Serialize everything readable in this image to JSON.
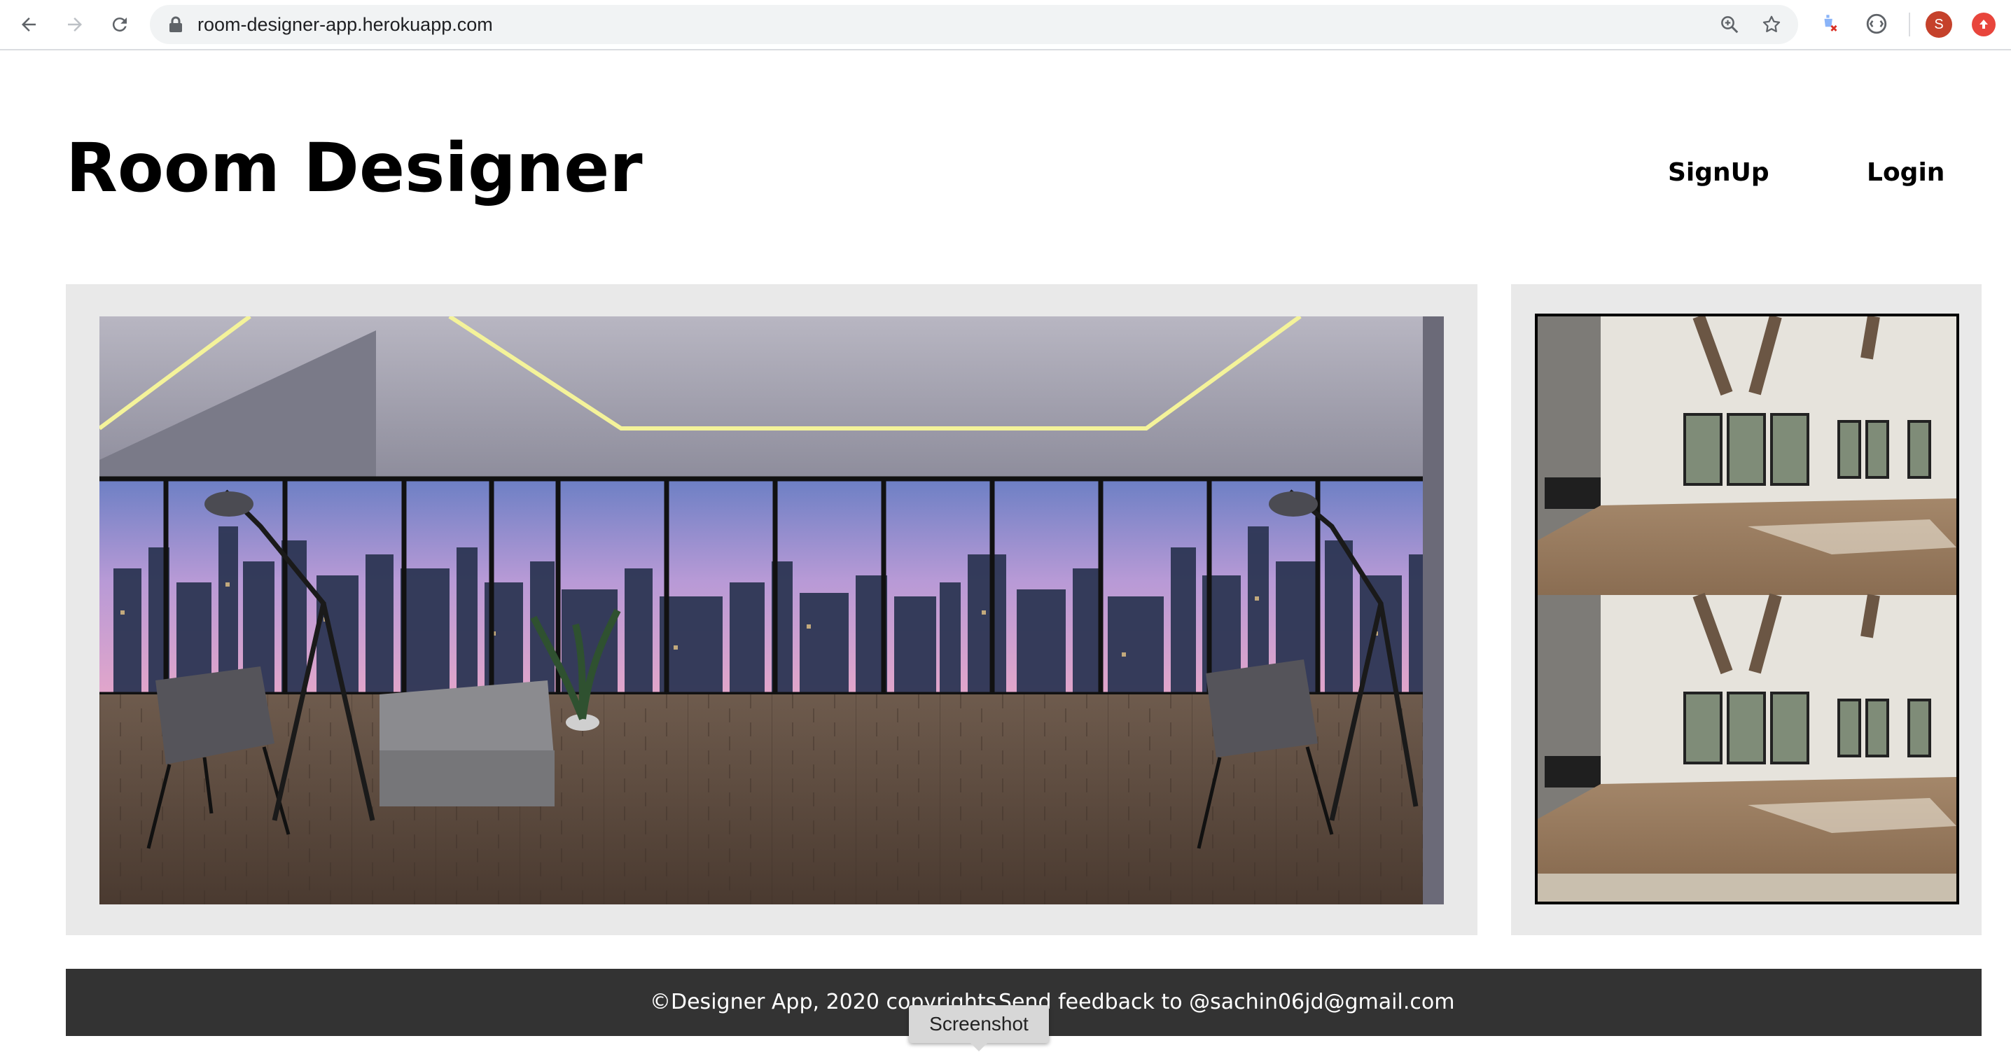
{
  "browser": {
    "url": "room-designer-app.herokuapp.com",
    "profile_initial": "S",
    "icons": [
      "back-icon",
      "forward-icon",
      "reload-icon",
      "lock-icon",
      "zoom-icon",
      "star-icon",
      "extension-icon",
      "extension-icon",
      "profile-avatar",
      "update-icon"
    ]
  },
  "header": {
    "title": "Room Designer",
    "nav": {
      "signup": "SignUp",
      "login": "Login"
    }
  },
  "footer": {
    "copyright": "©Designer App, 2020 copyrights",
    "feedback": "Send feedback to @sachin06jd@gmail.com"
  },
  "tooltip": {
    "label": "Screenshot"
  },
  "colors": {
    "panel_bg": "#e9e9e9",
    "footer_bg": "#333333",
    "avatar": "#c5412b"
  }
}
